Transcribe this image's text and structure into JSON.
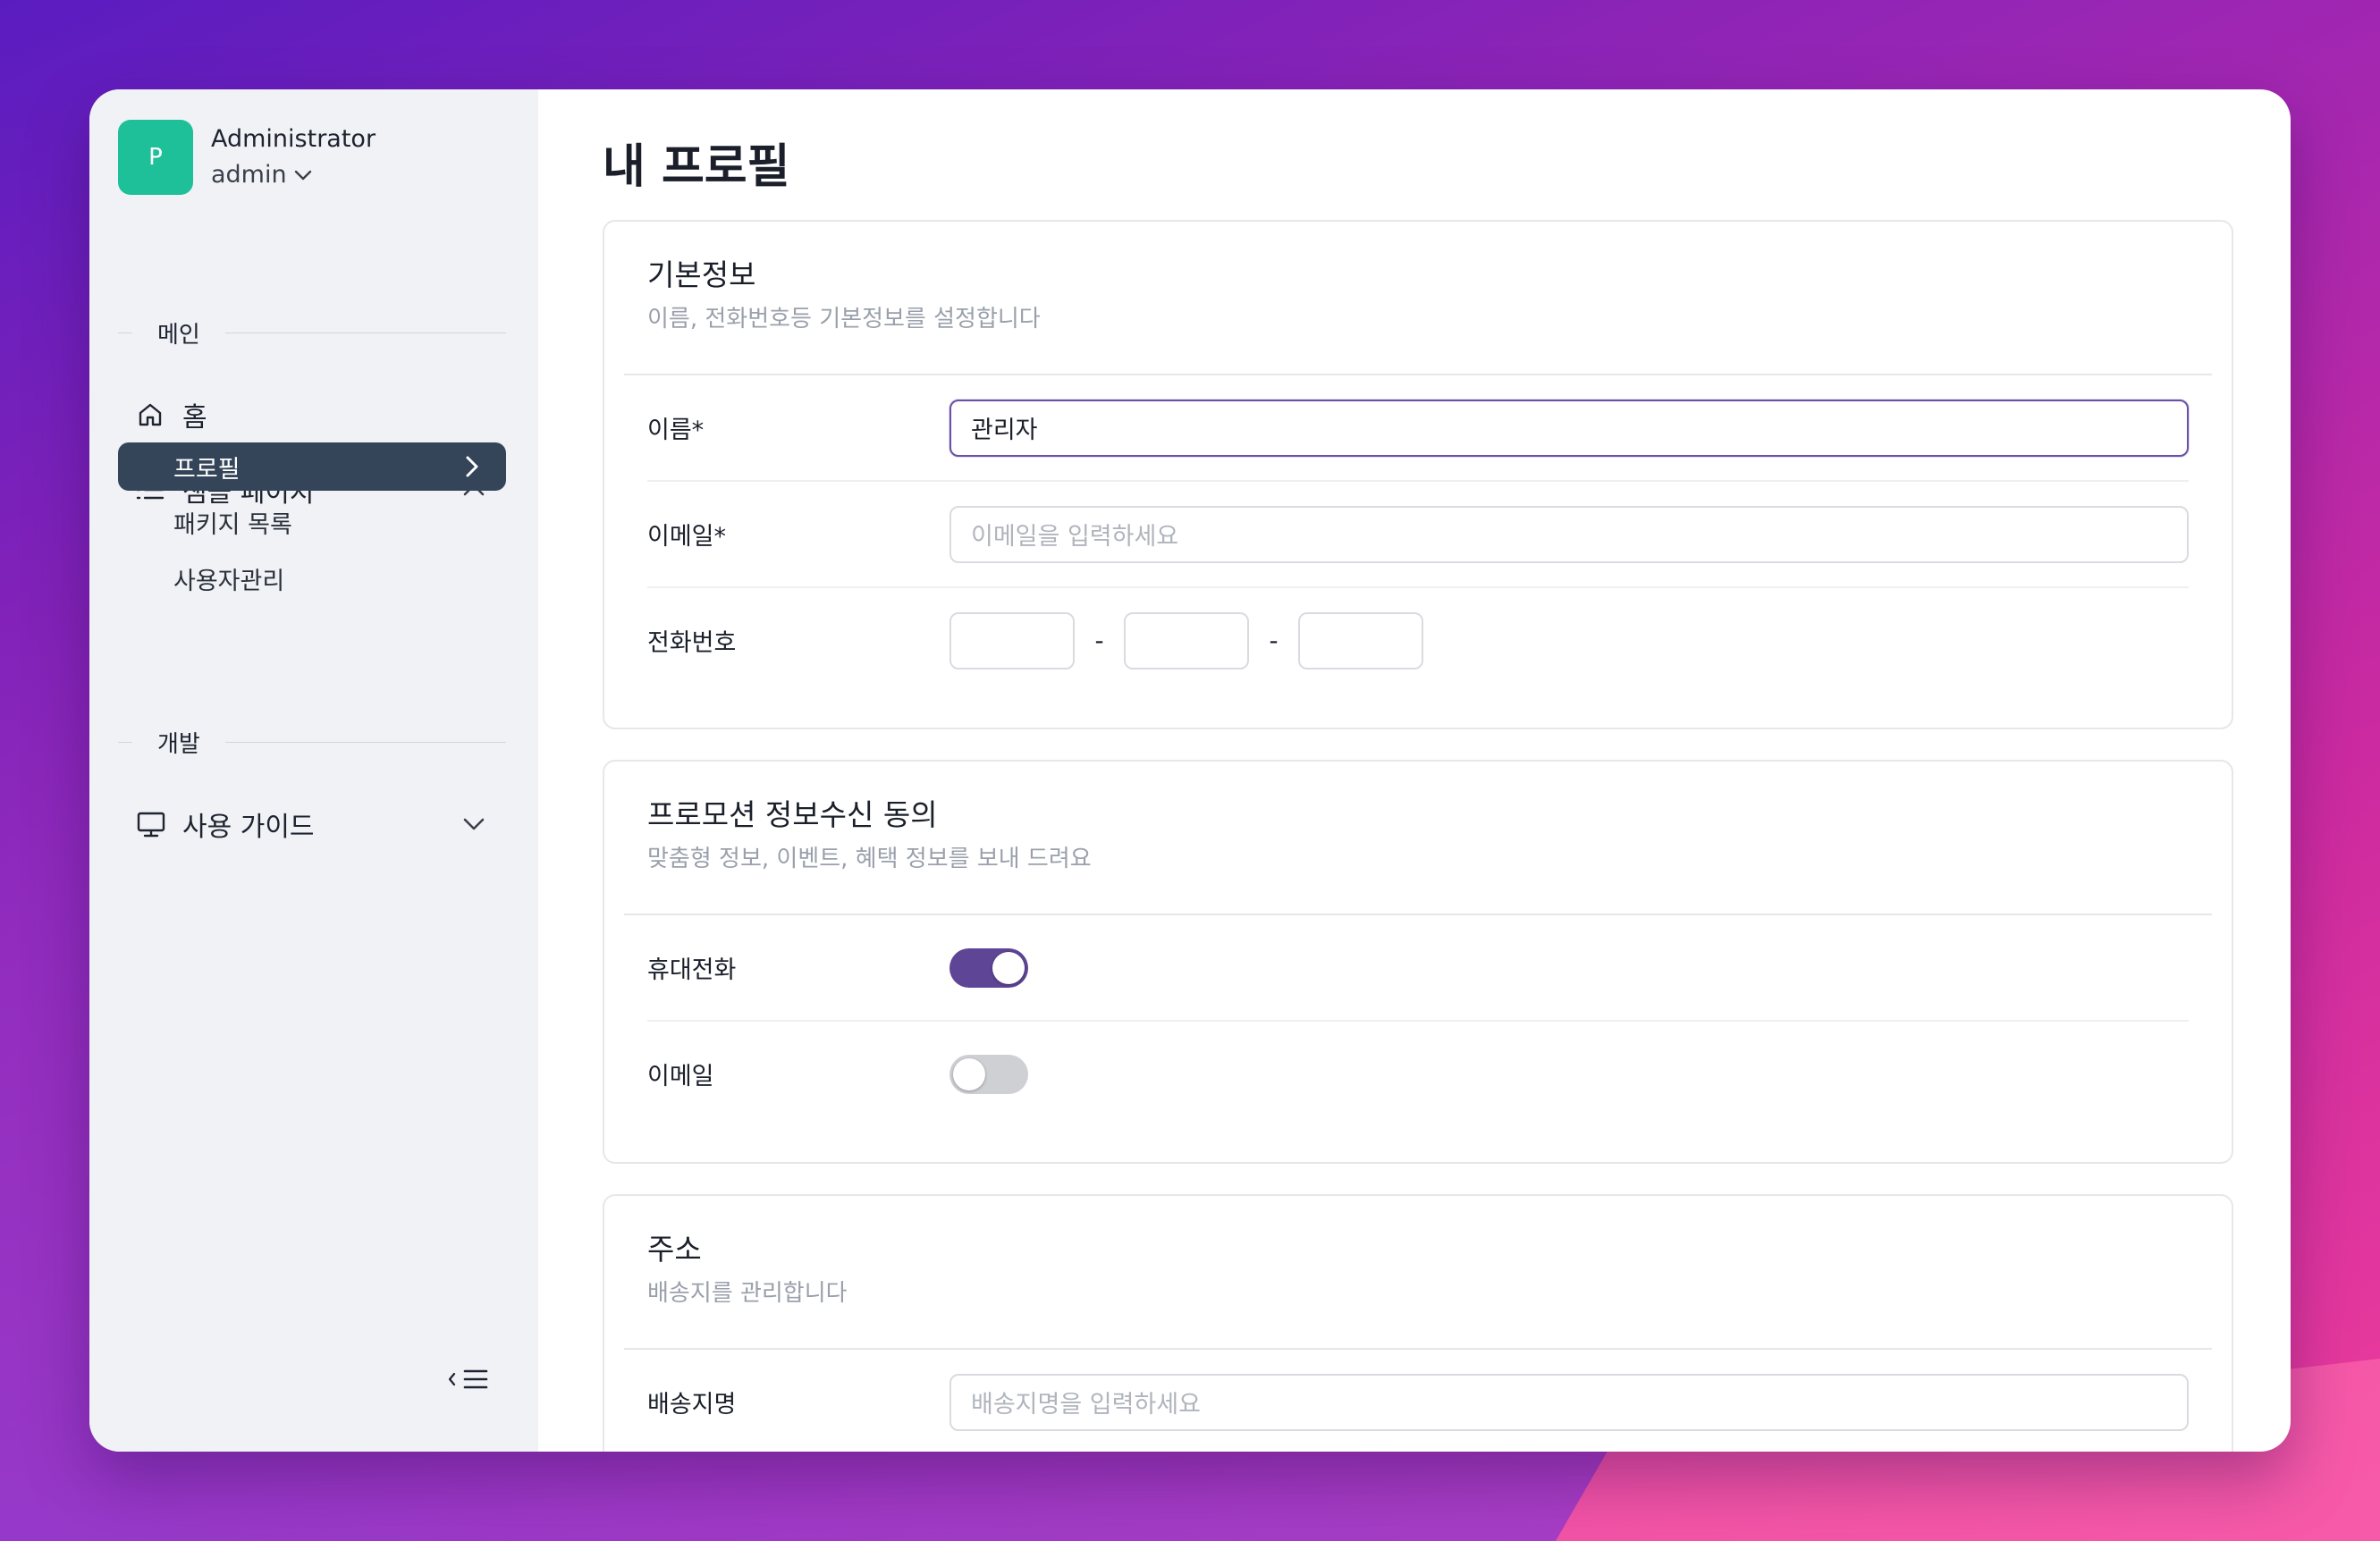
{
  "user": {
    "avatar_letter": "P",
    "name": "Administrator",
    "role": "admin"
  },
  "sidebar": {
    "sections": [
      {
        "label": "메인"
      },
      {
        "label": "개발"
      }
    ],
    "home": "홈",
    "sample": "샘플 페이지",
    "sub_items": [
      "프로필",
      "패키지 목록",
      "사용자관리"
    ],
    "guide": "사용 가이드"
  },
  "page": {
    "title": "내 프로필"
  },
  "basic": {
    "title": "기본정보",
    "subtitle": "이름, 전화번호등 기본정보를 설정합니다",
    "name_label": "이름*",
    "name_value": "관리자",
    "email_label": "이메일*",
    "email_placeholder": "이메일을 입력하세요",
    "phone_label": "전화번호",
    "phone_sep": "-"
  },
  "promo": {
    "title": "프로모션 정보수신 동의",
    "subtitle": "맞춤형 정보, 이벤트, 혜택 정보를 보내 드려요",
    "mobile_label": "휴대전화",
    "mobile_on": true,
    "email_label": "이메일",
    "email_on": false
  },
  "address": {
    "title": "주소",
    "subtitle": "배송지를 관리합니다",
    "ship_label": "배송지명",
    "ship_placeholder": "배송지명을 입력하세요"
  },
  "colors": {
    "accent": "#5e4595",
    "sidebar_active": "#344459",
    "avatar": "#1ec09a"
  }
}
